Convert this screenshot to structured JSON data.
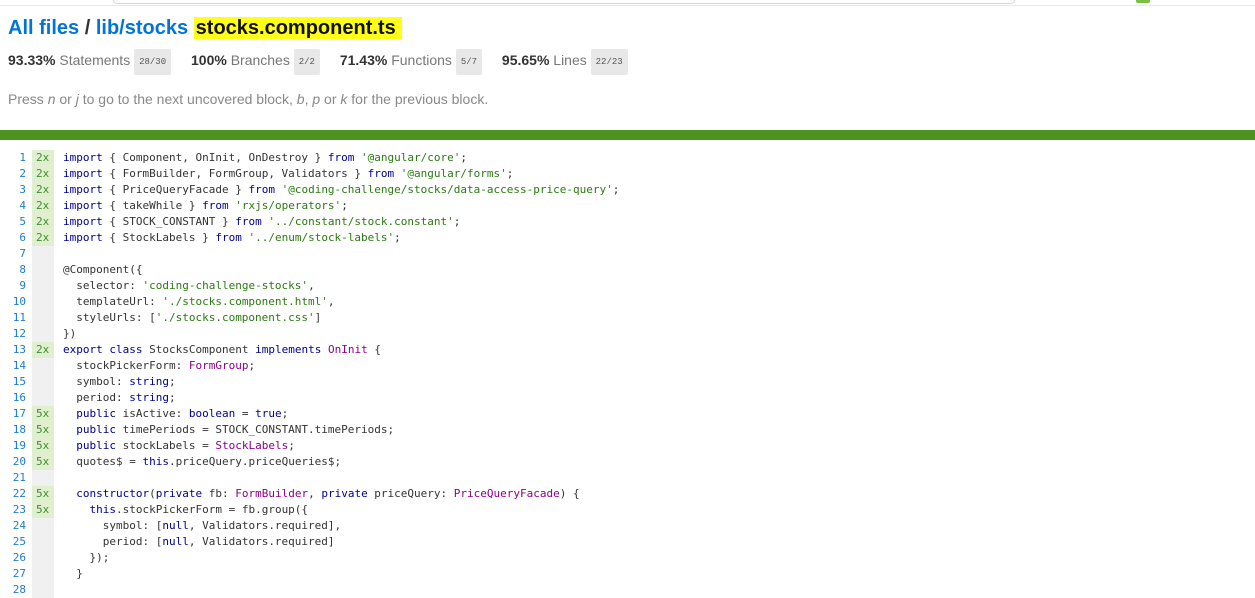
{
  "header": {
    "all_files": "All files",
    "separator": "/",
    "dir": "lib/stocks",
    "file": "stocks.component.ts"
  },
  "metrics": [
    {
      "pct": "93.33%",
      "label": "Statements",
      "frac": "28/30"
    },
    {
      "pct": "100%",
      "label": "Branches",
      "frac": "2/2"
    },
    {
      "pct": "71.43%",
      "label": "Functions",
      "frac": "5/7"
    },
    {
      "pct": "95.65%",
      "label": "Lines",
      "frac": "22/23"
    }
  ],
  "hint": {
    "p1": "Press ",
    "k1": "n",
    "p2": " or ",
    "k2": "j",
    "p3": " to go to the next uncovered block, ",
    "k3": "b",
    "p4": ", ",
    "k4": "p",
    "p5": " or ",
    "k5": "k",
    "p6": " for the previous block."
  },
  "colors": {
    "status_bar": "#4d9221",
    "highlight": "#ffff1a",
    "link": "#0074d9",
    "hit_bg": "#dfefcf"
  },
  "lines": [
    {
      "n": "1",
      "c": "2x",
      "code": "import { Component, OnInit, OnDestroy } from '@angular/core';"
    },
    {
      "n": "2",
      "c": "2x",
      "code": "import { FormBuilder, FormGroup, Validators } from '@angular/forms';"
    },
    {
      "n": "3",
      "c": "2x",
      "code": "import { PriceQueryFacade } from '@coding-challenge/stocks/data-access-price-query';"
    },
    {
      "n": "4",
      "c": "2x",
      "code": "import { takeWhile } from 'rxjs/operators';"
    },
    {
      "n": "5",
      "c": "2x",
      "code": "import { STOCK_CONSTANT } from '../constant/stock.constant';"
    },
    {
      "n": "6",
      "c": "2x",
      "code": "import { StockLabels } from '../enum/stock-labels';"
    },
    {
      "n": "7",
      "c": "",
      "code": ""
    },
    {
      "n": "8",
      "c": "",
      "code": "@Component({"
    },
    {
      "n": "9",
      "c": "",
      "code": "  selector: 'coding-challenge-stocks',"
    },
    {
      "n": "10",
      "c": "",
      "code": "  templateUrl: './stocks.component.html',"
    },
    {
      "n": "11",
      "c": "",
      "code": "  styleUrls: ['./stocks.component.css']"
    },
    {
      "n": "12",
      "c": "",
      "code": "})"
    },
    {
      "n": "13",
      "c": "2x",
      "code": "export class StocksComponent implements OnInit {"
    },
    {
      "n": "14",
      "c": "",
      "code": "  stockPickerForm: FormGroup;"
    },
    {
      "n": "15",
      "c": "",
      "code": "  symbol: string;"
    },
    {
      "n": "16",
      "c": "",
      "code": "  period: string;"
    },
    {
      "n": "17",
      "c": "5x",
      "code": "  public isActive: boolean = true;"
    },
    {
      "n": "18",
      "c": "5x",
      "code": "  public timePeriods = STOCK_CONSTANT.timePeriods;"
    },
    {
      "n": "19",
      "c": "5x",
      "code": "  public stockLabels = StockLabels;"
    },
    {
      "n": "20",
      "c": "5x",
      "code": "  quotes$ = this.priceQuery.priceQueries$;"
    },
    {
      "n": "21",
      "c": "",
      "code": ""
    },
    {
      "n": "22",
      "c": "5x",
      "code": "  constructor(private fb: FormBuilder, private priceQuery: PriceQueryFacade) {"
    },
    {
      "n": "23",
      "c": "5x",
      "code": "    this.stockPickerForm = fb.group({"
    },
    {
      "n": "24",
      "c": "",
      "code": "      symbol: [null, Validators.required],"
    },
    {
      "n": "25",
      "c": "",
      "code": "      period: [null, Validators.required]"
    },
    {
      "n": "26",
      "c": "",
      "code": "    });"
    },
    {
      "n": "27",
      "c": "",
      "code": "  }"
    },
    {
      "n": "28",
      "c": "",
      "code": ""
    }
  ]
}
